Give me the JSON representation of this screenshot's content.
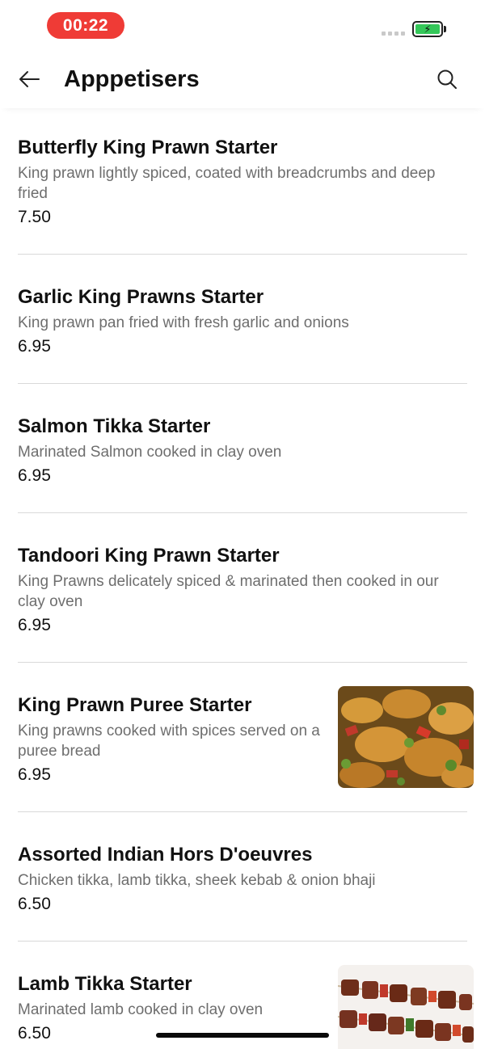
{
  "status_bar": {
    "time": "00:22",
    "battery_icon": "battery-charging-icon",
    "signal_icon": "signal-dots-icon"
  },
  "header": {
    "back_icon": "arrow-left-icon",
    "title": "Apppetisers",
    "search_icon": "search-icon"
  },
  "colors": {
    "time_pill": "#ef3b36",
    "battery": "#34c759",
    "divider": "#d9d9d9",
    "description": "#6e6e6e"
  },
  "items": [
    {
      "name": "Butterfly King Prawn Starter",
      "description": "King prawn lightly spiced, coated with breadcrumbs and deep fried",
      "price": "7.50",
      "image": null
    },
    {
      "name": "Garlic King Prawns Starter",
      "description": "King prawn pan fried with fresh garlic and onions",
      "price": "6.95",
      "image": null
    },
    {
      "name": "Salmon Tikka Starter",
      "description": "Marinated Salmon cooked in clay oven",
      "price": "6.95",
      "image": null
    },
    {
      "name": "Tandoori King Prawn Starter",
      "description": "King Prawns delicately spiced & marinated then cooked in our clay oven",
      "price": "6.95",
      "image": null
    },
    {
      "name": "King Prawn Puree Starter",
      "description": "King prawns cooked with spices served on a puree bread",
      "price": "6.95",
      "image": "prawn-curry-photo"
    },
    {
      "name": "Assorted Indian Hors D'oeuvres",
      "description": "Chicken tikka, lamb tikka, sheek kebab & onion bhaji",
      "price": "6.50",
      "image": null
    },
    {
      "name": "Lamb Tikka Starter",
      "description": "Marinated lamb cooked in clay oven",
      "price": "6.50",
      "image": "lamb-skewers-photo"
    }
  ]
}
